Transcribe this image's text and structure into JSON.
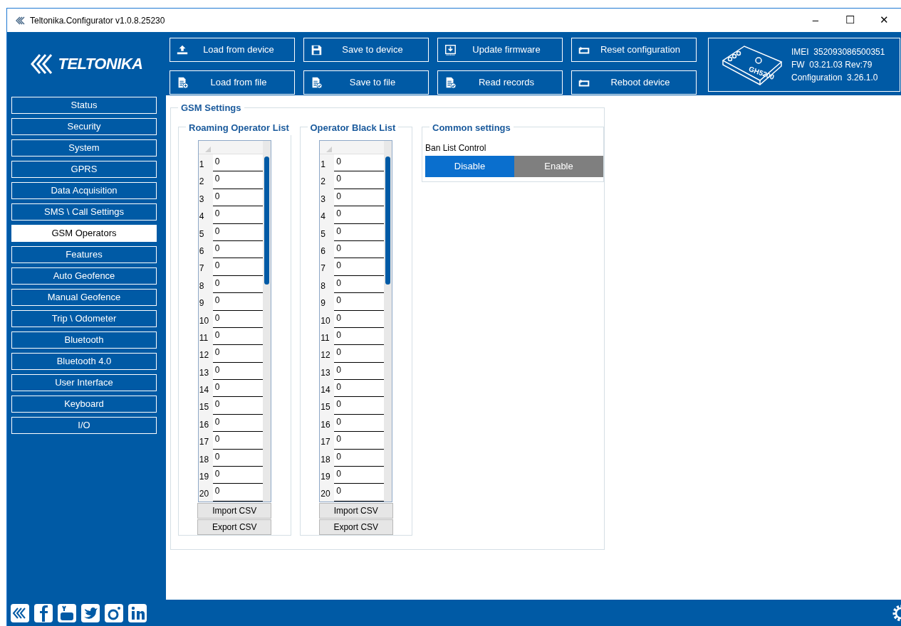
{
  "window": {
    "title": "Teltonika.Configurator v1.0.8.25230",
    "controls": [
      "–",
      "☐",
      "✕"
    ]
  },
  "brand": "TELTONIKA",
  "toolbar": [
    {
      "label": "Load from device",
      "kind": "upload"
    },
    {
      "label": "Save to device",
      "kind": "floppy"
    },
    {
      "label": "Update firmware",
      "kind": "firmware"
    },
    {
      "label": "Reset configuration",
      "kind": "reset"
    },
    {
      "label": "Load from file",
      "kind": "file-plus"
    },
    {
      "label": "Save to file",
      "kind": "file-check"
    },
    {
      "label": "Read records",
      "kind": "file-check"
    },
    {
      "label": "Reboot device",
      "kind": "reset"
    }
  ],
  "device": {
    "model": "GH5200",
    "lines": [
      "IMEI  352093086500351",
      "FW  03.21.03 Rev:79",
      "Configuration  3.26.1.0"
    ]
  },
  "sidebar": {
    "items": [
      {
        "label": "Status",
        "selected": false
      },
      {
        "label": "Security",
        "selected": false
      },
      {
        "label": "System",
        "selected": false
      },
      {
        "label": "GPRS",
        "selected": false
      },
      {
        "label": "Data Acquisition",
        "selected": false
      },
      {
        "label": "SMS \\ Call Settings",
        "selected": false
      },
      {
        "label": "GSM Operators",
        "selected": true
      },
      {
        "label": "Features",
        "selected": false
      },
      {
        "label": "Auto Geofence",
        "selected": false
      },
      {
        "label": "Manual Geofence",
        "selected": false
      },
      {
        "label": "Trip \\ Odometer",
        "selected": false
      },
      {
        "label": "Bluetooth",
        "selected": false
      },
      {
        "label": "Bluetooth 4.0",
        "selected": false
      },
      {
        "label": "User Interface",
        "selected": false
      },
      {
        "label": "Keyboard",
        "selected": false
      },
      {
        "label": "I/O",
        "selected": false
      }
    ]
  },
  "gsm_settings": {
    "title": "GSM Settings",
    "lists": [
      {
        "title": "Roaming Operator List",
        "rows": [
          [
            "1",
            "0"
          ],
          [
            "2",
            "0"
          ],
          [
            "3",
            "0"
          ],
          [
            "4",
            "0"
          ],
          [
            "5",
            "0"
          ],
          [
            "6",
            "0"
          ],
          [
            "7",
            "0"
          ],
          [
            "8",
            "0"
          ],
          [
            "9",
            "0"
          ],
          [
            "10",
            "0"
          ],
          [
            "11",
            "0"
          ],
          [
            "12",
            "0"
          ],
          [
            "13",
            "0"
          ],
          [
            "14",
            "0"
          ],
          [
            "15",
            "0"
          ],
          [
            "16",
            "0"
          ],
          [
            "17",
            "0"
          ],
          [
            "18",
            "0"
          ],
          [
            "19",
            "0"
          ],
          [
            "20",
            "0"
          ]
        ],
        "buttons": [
          "Import CSV",
          "Export CSV"
        ]
      },
      {
        "title": "Operator Black List",
        "rows": [
          [
            "1",
            "0"
          ],
          [
            "2",
            "0"
          ],
          [
            "3",
            "0"
          ],
          [
            "4",
            "0"
          ],
          [
            "5",
            "0"
          ],
          [
            "6",
            "0"
          ],
          [
            "7",
            "0"
          ],
          [
            "8",
            "0"
          ],
          [
            "9",
            "0"
          ],
          [
            "10",
            "0"
          ],
          [
            "11",
            "0"
          ],
          [
            "12",
            "0"
          ],
          [
            "13",
            "0"
          ],
          [
            "14",
            "0"
          ],
          [
            "15",
            "0"
          ],
          [
            "16",
            "0"
          ],
          [
            "17",
            "0"
          ],
          [
            "18",
            "0"
          ],
          [
            "19",
            "0"
          ],
          [
            "20",
            "0"
          ]
        ],
        "buttons": [
          "Import CSV",
          "Export CSV"
        ]
      }
    ],
    "common": {
      "title": "Common settings",
      "label": "Ban List Control",
      "options": [
        {
          "label": "Disable",
          "selected": true
        },
        {
          "label": "Enable",
          "selected": false
        }
      ]
    }
  }
}
